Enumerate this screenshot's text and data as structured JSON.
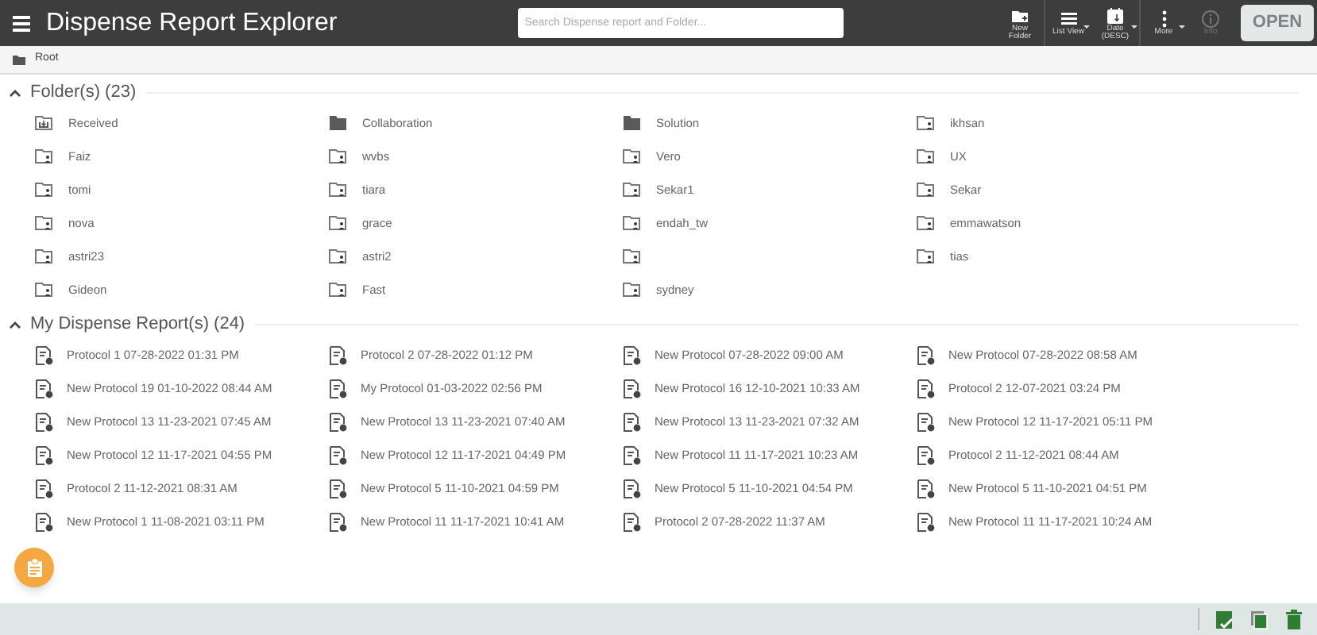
{
  "app_bar": {
    "title": "Dispense Report Explorer",
    "search": {
      "placeholder": "Search Dispense report and Folder..."
    },
    "tools": [
      {
        "kind": "new-folder",
        "label": "New Folder",
        "caret": false,
        "disabled": false
      },
      {
        "kind": "list",
        "label": "List View",
        "caret": true,
        "disabled": false
      },
      {
        "kind": "date",
        "label": "Date (DESC)",
        "caret": true,
        "disabled": false
      },
      {
        "kind": "more",
        "label": "More",
        "caret": true,
        "disabled": false
      },
      {
        "kind": "info",
        "label": "Info",
        "caret": false,
        "disabled": true
      }
    ],
    "open_button": {
      "label": "OPEN",
      "disabled": true
    }
  },
  "breadcrumb": [
    "Root"
  ],
  "folders": {
    "title": "Folder(s) (23)",
    "expanded": true,
    "items": [
      {
        "kind": "inbox",
        "name": "Received"
      },
      {
        "kind": "filled",
        "name": "Collaboration"
      },
      {
        "kind": "filled",
        "name": "Solution"
      },
      {
        "kind": "shared",
        "name": "ikhsan"
      },
      {
        "kind": "shared",
        "name": "Faiz"
      },
      {
        "kind": "shared",
        "name": "wvbs"
      },
      {
        "kind": "shared",
        "name": "Vero"
      },
      {
        "kind": "shared",
        "name": "UX"
      },
      {
        "kind": "shared",
        "name": "tomi"
      },
      {
        "kind": "shared",
        "name": "tiara"
      },
      {
        "kind": "shared",
        "name": "Sekar1"
      },
      {
        "kind": "shared",
        "name": "Sekar"
      },
      {
        "kind": "shared",
        "name": "nova"
      },
      {
        "kind": "shared",
        "name": "grace"
      },
      {
        "kind": "shared",
        "name": "endah_tw"
      },
      {
        "kind": "shared",
        "name": "emmawatson"
      },
      {
        "kind": "shared",
        "name": "astri23"
      },
      {
        "kind": "shared",
        "name": "astri2"
      },
      {
        "kind": "shared"
      },
      {
        "kind": "shared",
        "name": "tias"
      },
      {
        "kind": "shared",
        "name": "Gideon"
      },
      {
        "kind": "shared",
        "name": "Fast"
      },
      {
        "kind": "shared",
        "name": "sydney"
      }
    ]
  },
  "reports": {
    "title": "My Dispense Report(s) (24)",
    "expanded": true,
    "items": [
      "Protocol 1 07-28-2022 01:31 PM",
      "Protocol 2 07-28-2022 01:12 PM",
      "New Protocol 07-28-2022 09:00 AM",
      "New Protocol 07-28-2022 08:58 AM",
      "New Protocol 19 01-10-2022 08:44 AM",
      "My Protocol 01-03-2022 02:56 PM",
      "New Protocol 16 12-10-2021 10:33 AM",
      "Protocol 2 12-07-2021 03:24 PM",
      "New Protocol 13 11-23-2021 07:45 AM",
      "New Protocol 13 11-23-2021 07:40 AM",
      "New Protocol 13 11-23-2021 07:32 AM",
      "New Protocol 12 11-17-2021 05:11 PM",
      "New Protocol 12 11-17-2021 04:55 PM",
      "New Protocol 12 11-17-2021 04:49 PM",
      "New Protocol 11 11-17-2021 10:23 AM",
      "Protocol 2 11-12-2021 08:44 AM",
      "Protocol 2 11-12-2021 08:31 AM",
      "New Protocol 5 11-10-2021 04:59 PM",
      "New Protocol 5 11-10-2021 04:54 PM",
      "New Protocol 5 11-10-2021 04:51 PM",
      "New Protocol 1 11-08-2021 03:11 PM",
      "New Protocol 11 11-17-2021 10:41 AM",
      "Protocol 2 07-28-2022 11:37 AM",
      "New Protocol 11 11-17-2021 10:24 AM"
    ]
  },
  "status_bar": {
    "tools": [
      {
        "kind": "check"
      },
      {
        "kind": "copy"
      },
      {
        "kind": "delete"
      }
    ]
  }
}
